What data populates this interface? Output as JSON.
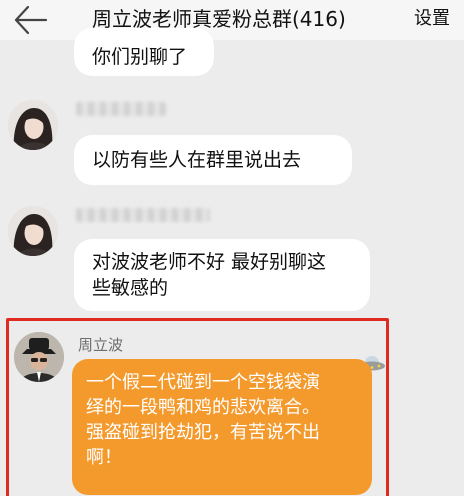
{
  "header": {
    "back_icon": "arrow-left-icon",
    "title": "周立波老师真爱粉总群(416)",
    "settings_label": "设置"
  },
  "messages": [
    {
      "sender": "",
      "text": "你们别聊了",
      "cut_off": true
    },
    {
      "sender": "",
      "sender_blurred": true,
      "text": "以防有些人在群里说出去"
    },
    {
      "sender": "",
      "sender_blurred": true,
      "text_lines": [
        "对波波老师不好  最好别聊这",
        "些敏感的"
      ]
    },
    {
      "sender": "周立波",
      "highlighted": true,
      "bubble_color": "#f49a2d",
      "badge_icon": "ufo-icon",
      "text_lines": [
        "一个假二代碰到一个空钱袋演",
        "绎的一段鸭和鸡的悲欢离合。",
        "强盗碰到抢劫犯，有苦说不出",
        "啊！"
      ]
    }
  ],
  "colors": {
    "highlight_border": "#e02a1f",
    "chat_background": "#ececec",
    "bubble_white": "#ffffff"
  }
}
